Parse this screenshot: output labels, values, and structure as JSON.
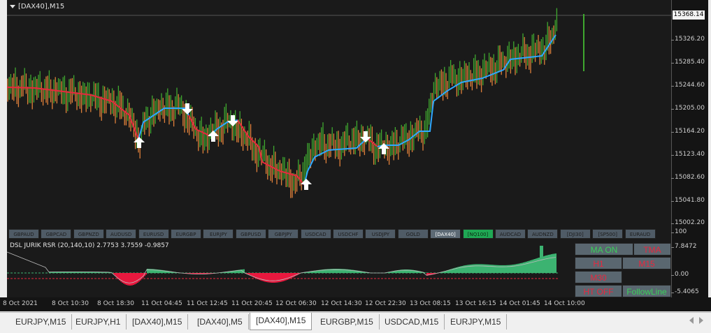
{
  "chart": {
    "title": "[DAX40],M15",
    "current_price": "15368.14",
    "price_ticks": [
      "15326.20",
      "15285.40",
      "15244.60",
      "15205.00",
      "15164.20",
      "15123.40",
      "15082.60",
      "15041.80",
      "15002.20"
    ],
    "colors": {
      "up": "#3fa82f",
      "down": "#e0803a",
      "ma_up": "#2ea8ff",
      "ma_down": "#e8283e"
    }
  },
  "symbols": [
    {
      "label": "GBPAUD"
    },
    {
      "label": "GBPCAD"
    },
    {
      "label": "GBPNZD"
    },
    {
      "label": "AUDUSD"
    },
    {
      "label": "EURUSD"
    },
    {
      "label": "EURGBP"
    },
    {
      "label": "EURJPY"
    },
    {
      "label": "GBPUSD"
    },
    {
      "label": "GBPJPY"
    },
    {
      "label": "USDCAD"
    },
    {
      "label": "USDCHF"
    },
    {
      "label": "USDJPY"
    },
    {
      "label": "GOLD"
    },
    {
      "label": "[DAX40]"
    },
    {
      "label": "[NQ100]"
    },
    {
      "label": "AUDCAD"
    },
    {
      "label": "AUDNZD"
    },
    {
      "label": "[DJI30]"
    },
    {
      "label": "[SP500]"
    },
    {
      "label": "EURAUD"
    }
  ],
  "indicator": {
    "title": "DSL JURIK RSR (20,140,10) 2.7753 3.7559 -0.9857",
    "axis_ticks": [
      "100",
      "7.8472",
      "0.00",
      "-5.4065",
      "0"
    ],
    "colors": {
      "pos": "#3cb371",
      "neg": "#e8183e"
    }
  },
  "panel": {
    "ma_on": "MA ON",
    "tma": "TMA",
    "h1": "H1",
    "m15": "M15",
    "m30": "M30",
    "ht_off": "HT OFF",
    "follow_line": "FollowLine"
  },
  "time_axis": [
    "8 Oct 2021",
    "8 Oct 10:30",
    "8 Oct 18:30",
    "11 Oct 04:45",
    "11 Oct 12:45",
    "11 Oct 20:45",
    "12 Oct 06:30",
    "12 Oct 14:30",
    "12 Oct 22:30",
    "13 Oct 08:15",
    "13 Oct 16:15",
    "14 Oct 01:45",
    "14 Oct 10:00"
  ],
  "tabs": [
    "EURJPY,M15",
    "EURJPY,H1",
    "[DAX40],M15",
    "[DAX40],M5",
    "[DAX40],M15",
    "EURGBP,M15",
    "USDCAD,M15",
    "EURJPY,M15"
  ],
  "active_tab": 4
}
